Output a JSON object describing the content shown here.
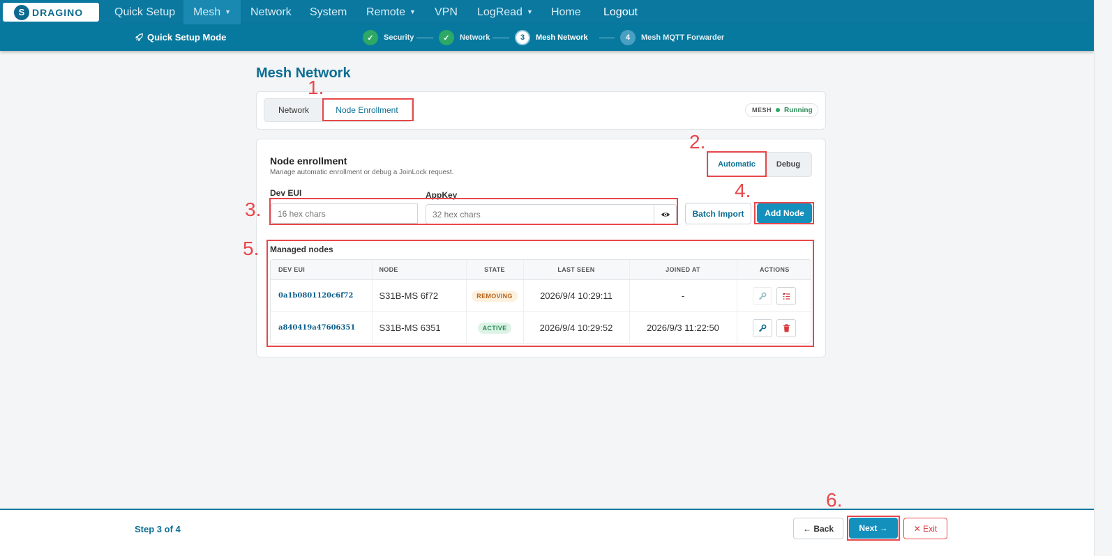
{
  "nav": {
    "logo_text": "DRAGINO",
    "items": [
      {
        "label": "Quick Setup"
      },
      {
        "label": "Mesh"
      },
      {
        "label": "Network"
      },
      {
        "label": "System"
      },
      {
        "label": "Remote"
      },
      {
        "label": "VPN"
      },
      {
        "label": "LogRead"
      },
      {
        "label": "Home"
      },
      {
        "label": "Logout"
      }
    ]
  },
  "stepper": {
    "mode_label": "Quick Setup Mode",
    "steps": [
      {
        "num": "✓",
        "label": "Security",
        "state": "done"
      },
      {
        "num": "✓",
        "label": "Network",
        "state": "done"
      },
      {
        "num": "3",
        "label": "Mesh Network",
        "state": "current"
      },
      {
        "num": "4",
        "label": "Mesh MQTT Forwarder",
        "state": "todo"
      }
    ]
  },
  "page": {
    "title": "Mesh Network"
  },
  "tabs": [
    {
      "label": "Network"
    },
    {
      "label": "Node Enrollment"
    }
  ],
  "status_badge": {
    "tag": "MESH",
    "status": "Running"
  },
  "enrollment": {
    "title": "Node enrollment",
    "subtitle": "Manage automatic enrollment or debug a JoinLock request.",
    "modes": [
      {
        "label": "Automatic"
      },
      {
        "label": "Debug"
      }
    ],
    "dev_eui_label": "Dev EUI",
    "dev_eui_placeholder": "16 hex chars",
    "appkey_label": "AppKey",
    "appkey_placeholder": "32 hex chars",
    "batch_import_label": "Batch Import",
    "add_node_label": "Add Node"
  },
  "managed_nodes": {
    "title": "Managed nodes",
    "columns": [
      "DEV EUI",
      "NODE",
      "STATE",
      "LAST SEEN",
      "JOINED AT",
      "ACTIONS"
    ],
    "rows": [
      {
        "dev_eui": "0a1b0801120c6f72",
        "node": "S31B-MS 6f72",
        "state": "REMOVING",
        "last_seen": "2026/9/4 10:29:11",
        "joined_at": "-"
      },
      {
        "dev_eui": "a840419a47606351",
        "node": "S31B-MS 6351",
        "state": "ACTIVE",
        "last_seen": "2026/9/4 10:29:52",
        "joined_at": "2026/9/3 11:22:50"
      }
    ]
  },
  "annotations": [
    "1.",
    "2.",
    "3.",
    "4.",
    "5.",
    "6."
  ],
  "footer": {
    "step_text": "Step 3 of 4",
    "back_label": "← Back",
    "next_label": "Next →",
    "exit_label": "✕ Exit"
  },
  "colors": {
    "primary": "#0b78a0",
    "accent_button": "#1390bc",
    "annotation": "#e8474b",
    "success": "#2ea865"
  }
}
